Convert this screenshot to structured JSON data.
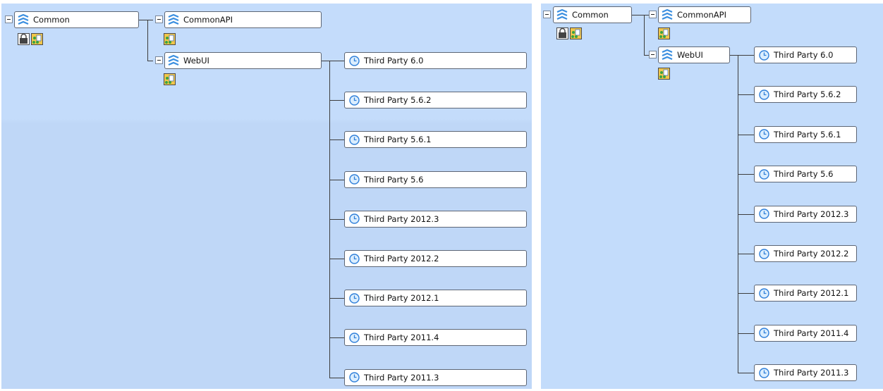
{
  "panels": {
    "left": {
      "root": {
        "label": "Common"
      },
      "children": [
        {
          "label": "CommonAPI"
        },
        {
          "label": "WebUI"
        }
      ],
      "releases": [
        "Third Party 6.0",
        "Third Party 5.6.2",
        "Third Party 5.6.1",
        "Third Party 5.6",
        "Third Party 2012.3",
        "Third Party 2012.2",
        "Third Party 2012.1",
        "Third Party 2011.4",
        "Third Party 2011.3"
      ]
    },
    "right": {
      "root": {
        "label": "Common"
      },
      "children": [
        {
          "label": "CommonAPI"
        },
        {
          "label": "WebUI"
        }
      ],
      "releases": [
        "Third Party 6.0",
        "Third Party 5.6.2",
        "Third Party 5.6.1",
        "Third Party 5.6",
        "Third Party 2012.3",
        "Third Party 2012.2",
        "Third Party 2012.1",
        "Third Party 2011.4",
        "Third Party 2011.3"
      ]
    }
  },
  "icons": {
    "project": "waves-icon",
    "release": "clock-icon",
    "lock": "lock-icon",
    "config": "config-icon",
    "expander": "collapse-icon"
  },
  "colors": {
    "background": "#c3dbfb",
    "node_border": "#5d6675",
    "connector": "#3d3d3d",
    "accent": "#2f7fd9"
  }
}
